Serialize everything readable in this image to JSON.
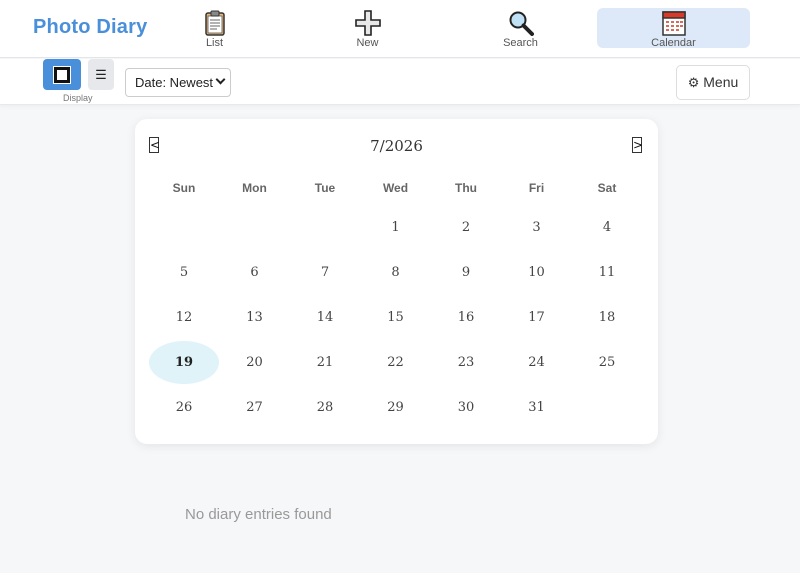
{
  "app": {
    "brand": "Photo Diary"
  },
  "nav": {
    "items": [
      {
        "label": "List",
        "icon": "clipboard-icon"
      },
      {
        "label": "New",
        "icon": "plus-icon"
      },
      {
        "label": "Search",
        "icon": "magnifier-icon"
      },
      {
        "label": "Calendar",
        "icon": "calendar-icon",
        "active": true
      }
    ]
  },
  "toolbar": {
    "display_label": "Display",
    "list_glyph": "☰",
    "sort_value": "Date: Newest",
    "menu_label": "Menu",
    "menu_icon": "⚙"
  },
  "calendar": {
    "prev": "<",
    "next": ">",
    "title": "7/2026",
    "weekdays": [
      "Sun",
      "Mon",
      "Tue",
      "Wed",
      "Thu",
      "Fri",
      "Sat"
    ],
    "first_weekday_index": 3,
    "days_in_month": 31,
    "selected_day": 19,
    "today_color": "#dff3f8"
  },
  "empty_message": "No diary entries found",
  "colors": {
    "accent": "#4a8fd9",
    "active_tab": "#dde9f8"
  }
}
